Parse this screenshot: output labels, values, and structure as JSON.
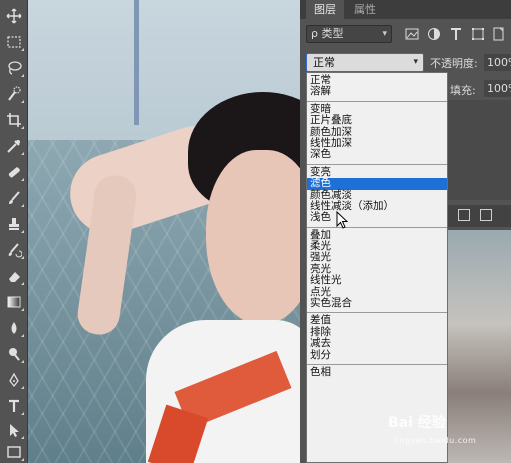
{
  "panel": {
    "tabs": [
      {
        "label": "图层",
        "active": true
      },
      {
        "label": "属性",
        "active": false
      }
    ],
    "filter": {
      "kind_label": "ρ 类型",
      "icons": [
        "image-filter-icon",
        "adjustment-filter-icon",
        "type-filter-icon",
        "shape-filter-icon",
        "smart-object-filter-icon"
      ]
    },
    "blend_mode": {
      "value": "正常"
    },
    "opacity": {
      "label": "不透明度:",
      "value": "100%"
    },
    "fill": {
      "label": "填充:",
      "value": "100%"
    }
  },
  "blend_menu": {
    "groups": [
      [
        "正常",
        "溶解"
      ],
      [
        "变暗",
        "正片叠底",
        "颜色加深",
        "线性加深",
        "深色"
      ],
      [
        "变亮",
        "滤色",
        "颜色减淡",
        "线性减淡（添加）",
        "浅色"
      ],
      [
        "叠加",
        "柔光",
        "强光",
        "亮光",
        "线性光",
        "点光",
        "实色混合"
      ],
      [
        "差值",
        "排除",
        "减去",
        "划分"
      ],
      [
        "色相"
      ]
    ],
    "selected": "滤色"
  },
  "toolbar": {
    "tools": [
      "move-tool-icon",
      "marquee-tool-icon",
      "lasso-tool-icon",
      "quick-selection-tool-icon",
      "crop-tool-icon",
      "eyedropper-tool-icon",
      "healing-brush-tool-icon",
      "brush-tool-icon",
      "clone-stamp-tool-icon",
      "history-brush-tool-icon",
      "eraser-tool-icon",
      "gradient-tool-icon",
      "blur-tool-icon",
      "dodge-tool-icon",
      "pen-tool-icon",
      "type-tool-icon",
      "path-selection-tool-icon",
      "rectangle-tool-icon"
    ]
  },
  "watermark": {
    "text": "Bai 经验",
    "sub": "jingyan.baidu.com"
  },
  "colors": {
    "accent": "#1e6fd6",
    "panel_bg": "#535353",
    "menu_bg": "#f0f0f0"
  }
}
